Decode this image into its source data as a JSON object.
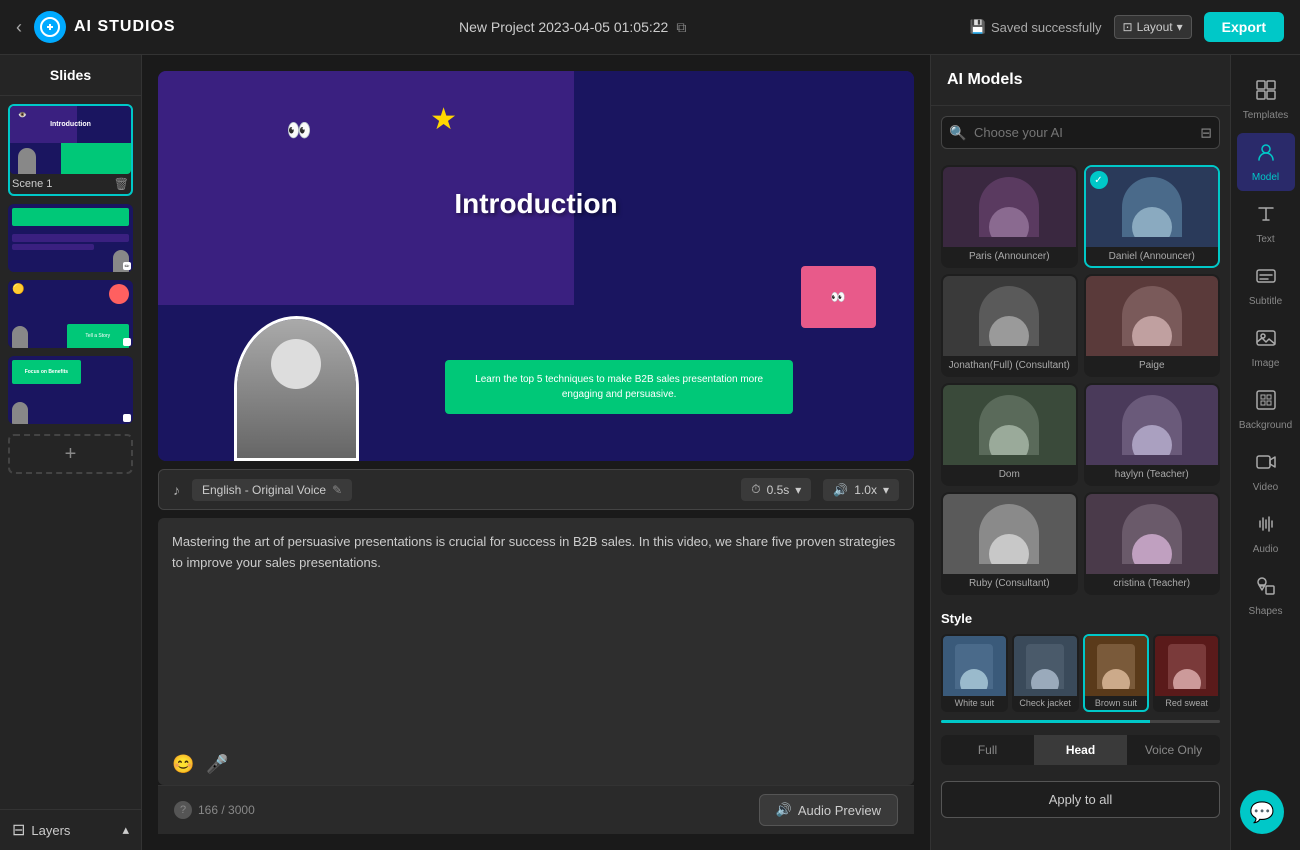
{
  "app": {
    "logo_text": "AI STUDIOS",
    "project_title": "New Project 2023-04-05 01:05:22",
    "saved_status": "Saved successfully",
    "layout_label": "Layout",
    "export_label": "Export"
  },
  "slides": {
    "header": "Slides",
    "items": [
      {
        "label": "Scene 1",
        "active": true
      },
      {
        "label": "",
        "active": false
      },
      {
        "label": "",
        "active": false
      },
      {
        "label": "",
        "active": false
      }
    ],
    "add_label": "+",
    "layers_label": "Layers"
  },
  "canvas": {
    "title": "Introduction",
    "subtitle": "Learn the top 5 techniques to make B2B sales presentation more engaging and persuasive."
  },
  "controls": {
    "voice_label": "English - Original Voice",
    "time_label": "0.5s",
    "speed_label": "1.0x"
  },
  "script": {
    "text": "Mastering the art of persuasive presentations is crucial for success in B2B sales. In this video, we share five proven strategies to improve your sales presentations.",
    "char_count": "166",
    "char_max": "3000"
  },
  "audio_preview": {
    "label": "Audio Preview"
  },
  "ai_models": {
    "header": "AI Models",
    "search_placeholder": "Choose your AI",
    "models": [
      {
        "name": "Paris (Announcer)",
        "selected": false,
        "color": "#3a2840"
      },
      {
        "name": "Daniel (Announcer)",
        "selected": true,
        "color": "#2a3a5a"
      },
      {
        "name": "Jonathan(Full) (Consultant)",
        "selected": false,
        "color": "#3a3a3a"
      },
      {
        "name": "Paige",
        "selected": false,
        "color": "#5a3a3a"
      },
      {
        "name": "Dom",
        "selected": false,
        "color": "#3a4a3a"
      },
      {
        "name": "haylyn (Teacher)",
        "selected": false,
        "color": "#4a3a5a"
      },
      {
        "name": "Ruby (Consultant)",
        "selected": false,
        "color": "#5a5a5a"
      },
      {
        "name": "cristina (Teacher)",
        "selected": false,
        "color": "#4a3a4a"
      }
    ],
    "style_section": "Style",
    "styles": [
      {
        "name": "White suit",
        "active": false
      },
      {
        "name": "Check jacket",
        "active": false
      },
      {
        "name": "Brown suit",
        "active": true
      },
      {
        "name": "Red sweat",
        "active": false
      }
    ],
    "positions": [
      {
        "label": "Full",
        "active": false
      },
      {
        "label": "Head",
        "active": true
      },
      {
        "label": "Voice Only",
        "active": false
      }
    ],
    "apply_label": "Apply to all"
  },
  "toolbar": {
    "items": [
      {
        "icon": "⊞",
        "label": "Templates"
      },
      {
        "icon": "👤",
        "label": "Model",
        "active": true
      },
      {
        "icon": "T",
        "label": "Text"
      },
      {
        "icon": "⊟",
        "label": "Subtitle"
      },
      {
        "icon": "🖼",
        "label": "Image"
      },
      {
        "icon": "▦",
        "label": "Background"
      },
      {
        "icon": "🎬",
        "label": "Video"
      },
      {
        "icon": "♪",
        "label": "Audio"
      },
      {
        "icon": "◇",
        "label": "Shapes"
      }
    ]
  }
}
